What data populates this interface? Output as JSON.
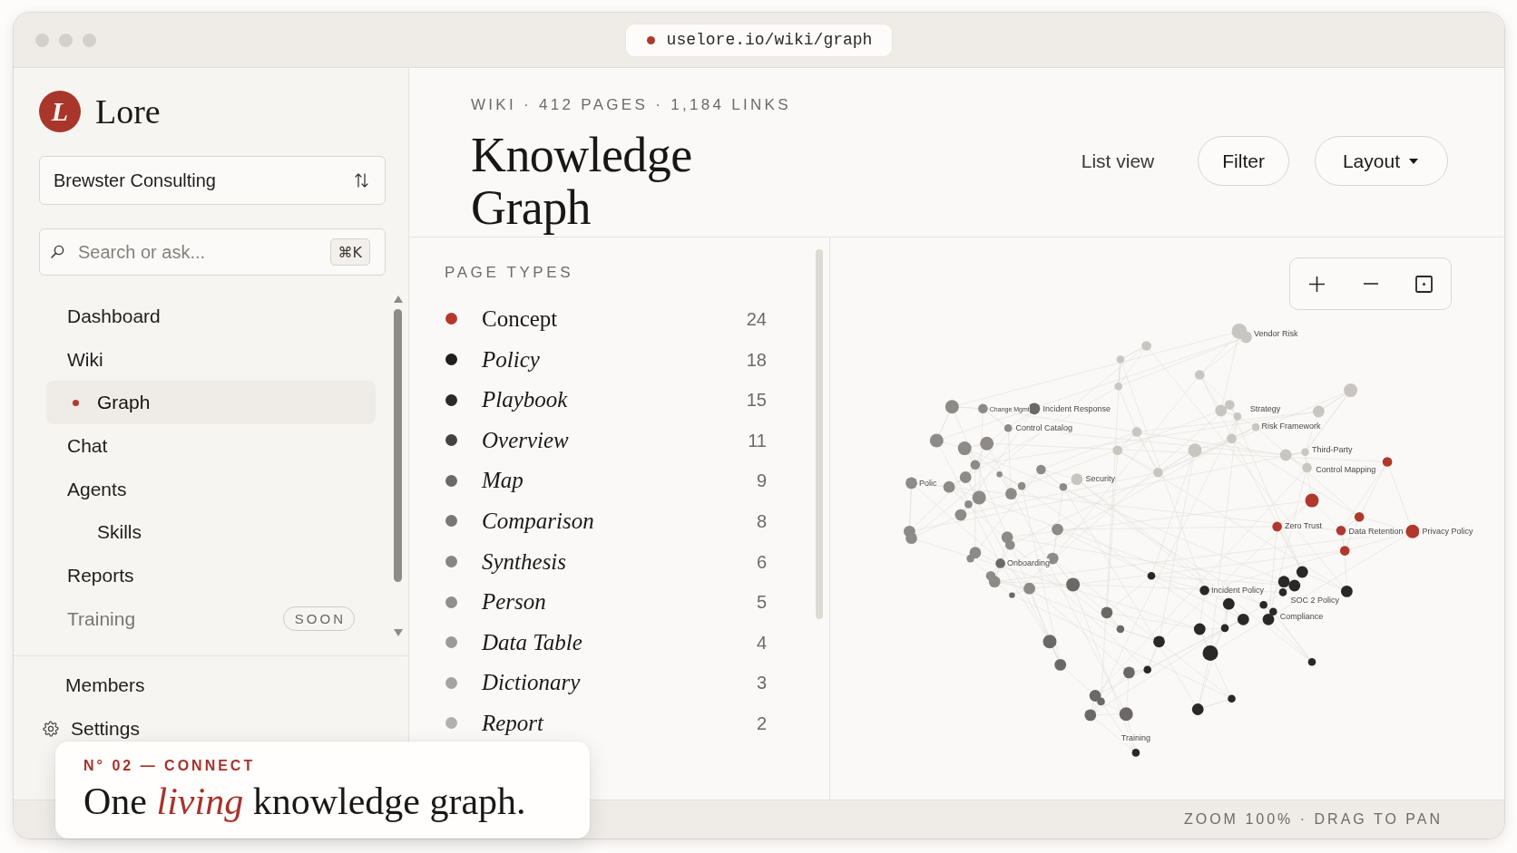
{
  "window": {
    "url": "uselore.io/wiki/graph"
  },
  "sidebar": {
    "brand": {
      "mark": "L",
      "name": "Lore"
    },
    "workspace": "Brewster Consulting",
    "search": {
      "placeholder": "Search or ask...",
      "shortcut": "⌘K"
    },
    "nav": [
      {
        "label": "Dashboard",
        "selected": false,
        "disabled": false
      },
      {
        "label": "Wiki",
        "selected": false,
        "disabled": false,
        "children": [
          {
            "label": "Graph",
            "selected": true,
            "disabled": false
          }
        ]
      },
      {
        "label": "Chat",
        "selected": false,
        "disabled": false
      },
      {
        "label": "Agents",
        "selected": false,
        "disabled": false,
        "children": [
          {
            "label": "Skills",
            "selected": false,
            "disabled": false
          }
        ]
      },
      {
        "label": "Reports",
        "selected": false,
        "disabled": false
      },
      {
        "label": "Training",
        "selected": false,
        "disabled": true,
        "badge": "SOON"
      }
    ],
    "footer_nav": [
      {
        "label": "Members",
        "kind": "plain"
      },
      {
        "label": "Settings",
        "kind": "settings"
      }
    ]
  },
  "header": {
    "meta": "WIKI · 412 PAGES · 1,184 LINKS",
    "title": "Knowledge Graph",
    "actions": [
      {
        "label": "List view",
        "kind": "link"
      },
      {
        "label": "Filter",
        "kind": "button"
      },
      {
        "label": "Layout",
        "kind": "menu"
      }
    ]
  },
  "page_types": {
    "title": "PAGE TYPES",
    "items": [
      {
        "label": "Concept",
        "count": "24",
        "color": "#b3392d",
        "selected": true
      },
      {
        "label": "Policy",
        "count": "18",
        "color": "#1f1e1d",
        "selected": false
      },
      {
        "label": "Playbook",
        "count": "15",
        "color": "#2b2a29",
        "selected": false
      },
      {
        "label": "Overview",
        "count": "11",
        "color": "#454341",
        "selected": false
      },
      {
        "label": "Map",
        "count": "9",
        "color": "#6c6a68",
        "selected": false
      },
      {
        "label": "Comparison",
        "count": "8",
        "color": "#7a7876",
        "selected": false
      },
      {
        "label": "Synthesis",
        "count": "6",
        "color": "#878583",
        "selected": false
      },
      {
        "label": "Person",
        "count": "5",
        "color": "#918f8d",
        "selected": false
      },
      {
        "label": "Data Table",
        "count": "4",
        "color": "#9c9a98",
        "selected": false
      },
      {
        "label": "Dictionary",
        "count": "3",
        "color": "#a6a4a2",
        "selected": false
      },
      {
        "label": "Report",
        "count": "2",
        "color": "#b2b0ae",
        "selected": false
      }
    ]
  },
  "graph": {
    "node_labels": [
      "Vendor Risk",
      "Change Mgmt",
      "Incident Response",
      "Control Catalog",
      "Strategy",
      "Risk Framework",
      "Third-Party",
      "Control Mapping",
      "Polic",
      "Security",
      "Onboarding",
      "Zero Trust",
      "Data Retention",
      "Privacy Policy",
      "Incident Policy",
      "SOC 2 Policy",
      "Compliance",
      "Training"
    ]
  },
  "status_bar": "ZOOM 100% · DRAG TO PAN",
  "caption": {
    "kicker": "N° 02 — CONNECT",
    "text": "One *living* knowledge graph."
  }
}
